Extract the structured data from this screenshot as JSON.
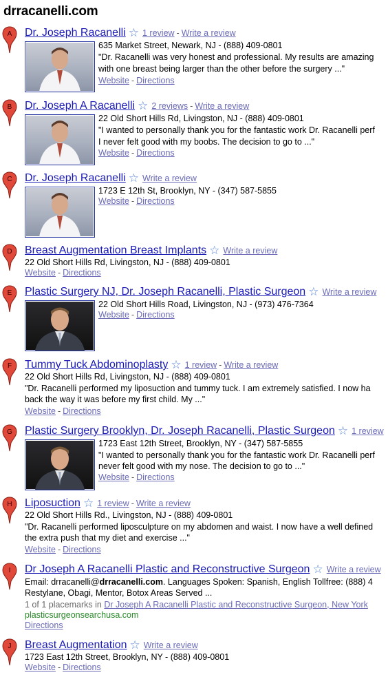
{
  "title": "drracanelli.com",
  "results": [
    {
      "letter": "A",
      "name": "Dr. Joseph Racanelli",
      "reviews": "1 review",
      "write": "Write a review",
      "address": "635 Market Street, Newark, NJ - (888) 409-0801",
      "snippet1": "\"Dr. Racanelli was very honest and professional. My results are amazing",
      "snippet2": "with one breast being larger than the other before the surgery ...\"",
      "website": "Website",
      "directions": "Directions"
    },
    {
      "letter": "B",
      "name": "Dr. Joseph A Racanelli",
      "reviews": "2 reviews",
      "write": "Write a review",
      "address": "22 Old Short Hills Rd, Livingston, NJ - (888) 409-0801",
      "snippet1": "\"I wanted to personally thank you for the fantastic work Dr. Racanelli perf",
      "snippet2": "I never felt good with my boobs. The decision to go to ...\"",
      "website": "Website",
      "directions": "Directions"
    },
    {
      "letter": "C",
      "name": "Dr. Joseph Racanelli",
      "write": "Write a review",
      "address": "1723 E 12th St, Brooklyn, NY - (347) 587-5855",
      "website": "Website",
      "directions": "Directions"
    },
    {
      "letter": "D",
      "name": "Breast Augmentation Breast Implants",
      "write": "Write a review",
      "address": "22 Old Short Hills Rd, Livingston, NJ - (888) 409-0801",
      "website": "Website",
      "directions": "Directions"
    },
    {
      "letter": "E",
      "name": "Plastic Surgery NJ, Dr. Joseph Racanelli, Plastic Surgeon",
      "write": "Write a review",
      "address": "22 Old Short Hills Road, Livingston, NJ - (973) 476-7364",
      "website": "Website",
      "directions": "Directions"
    },
    {
      "letter": "F",
      "name": "Tummy Tuck Abdominoplasty",
      "reviews": "1 review",
      "write": "Write a review",
      "address": "22 Old Short Hills Rd, Livingston, NJ - (888) 409-0801",
      "snippet1": "\"Dr. Racanelli performed my liposuction and tummy tuck. I am extremely satisfied. I now ha",
      "snippet2": "back the way it was before my first child. My ...\"",
      "website": "Website",
      "directions": "Directions"
    },
    {
      "letter": "G",
      "name": "Plastic Surgery Brooklyn, Dr. Joseph Racanelli, Plastic Surgeon",
      "reviews": "1 review",
      "address": "1723 East 12th Street, Brooklyn, NY - (347) 587-5855",
      "snippet1": "\"I wanted to personally thank you for the fantastic work Dr. Racanelli perf",
      "snippet2": "never felt good with my nose. The decision to go to ...\"",
      "website": "Website",
      "directions": "Directions"
    },
    {
      "letter": "H",
      "name": "Liposuction",
      "reviews": "1 review",
      "write": "Write a review",
      "address": "22 Old Short Hills Rd., Livingston, NJ - (888) 409-0801",
      "snippet1": "\"Dr. Racanelli performed liposculpture on my abdomen and waist. I now have a well defined",
      "snippet2": "the extra push that my diet and exercise ...\"",
      "website": "Website",
      "directions": "Directions"
    },
    {
      "letter": "I",
      "name": "Dr Joseph A Racanelli Plastic and Reconstructive Surgeon",
      "write": "Write a review",
      "email_prefix": "Email: drracanelli@",
      "email_bold": "drracanelli.com",
      "email_suffix": ". Languages Spoken: Spanish, English Tollfree: (888) 4",
      "line2": "Restylane, Obagi, Mentor, Botox Areas Served ...",
      "placemarks": "1 of 1 placemarks in",
      "placemark_link": "Dr Joseph A Racanelli Plastic and Reconstructive Surgeon, New York",
      "url": "plasticsurgeonsearchusa.com",
      "directions": "Directions"
    },
    {
      "letter": "J",
      "name": "Breast Augmentation",
      "write": "Write a review",
      "address": "1723 East 12th Street, Brooklyn, NY - (888) 409-0801",
      "website": "Website",
      "directions": "Directions"
    }
  ],
  "colors": {
    "pin": "#e0483a",
    "link": "#1a1ab4",
    "visited_link": "#6a6ab6",
    "url": "#2a8a2a"
  }
}
